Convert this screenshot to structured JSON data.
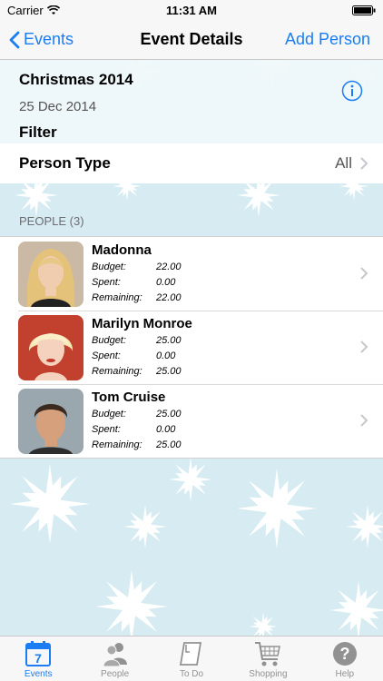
{
  "status": {
    "carrier": "Carrier",
    "time": "11:31 AM"
  },
  "nav": {
    "back_label": "Events",
    "title": "Event Details",
    "action_label": "Add Person"
  },
  "event": {
    "name": "Christmas 2014",
    "date": "25 Dec 2014"
  },
  "filter": {
    "section_label": "Filter",
    "person_type_label": "Person Type",
    "person_type_value": "All"
  },
  "people": {
    "section_header": "PEOPLE (3)",
    "field_labels": {
      "budget": "Budget:",
      "spent": "Spent:",
      "remaining": "Remaining:"
    },
    "items": [
      {
        "name": "Madonna",
        "budget": "22.00",
        "spent": "0.00",
        "remaining": "22.00"
      },
      {
        "name": "Marilyn Monroe",
        "budget": "25.00",
        "spent": "0.00",
        "remaining": "25.00"
      },
      {
        "name": "Tom Cruise",
        "budget": "25.00",
        "spent": "0.00",
        "remaining": "25.00"
      }
    ]
  },
  "tabs": [
    {
      "label": "Events",
      "icon": "calendar-icon",
      "badge": "7"
    },
    {
      "label": "People",
      "icon": "people-icon"
    },
    {
      "label": "To Do",
      "icon": "todo-icon"
    },
    {
      "label": "Shopping",
      "icon": "cart-icon"
    },
    {
      "label": "Help",
      "icon": "help-icon",
      "glyph": "?"
    }
  ],
  "colors": {
    "accent": "#1a7ef2",
    "background": "#d6ecf2",
    "inactive": "#929292"
  }
}
